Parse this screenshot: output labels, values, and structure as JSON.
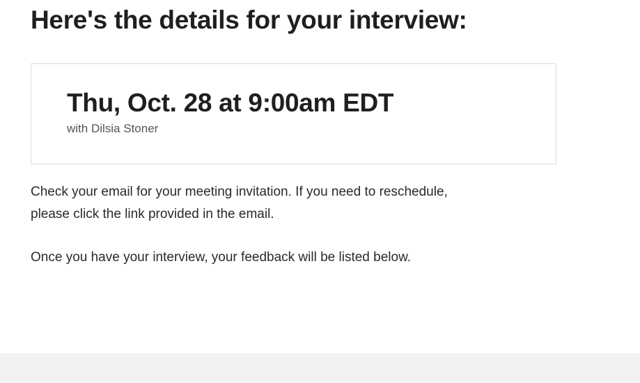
{
  "page": {
    "title": "Here's the details for your interview:"
  },
  "interview": {
    "datetime": "Thu, Oct. 28 at 9:00am EDT",
    "interviewer": "with Dilsia Stoner"
  },
  "info": {
    "line1": "Check your email for your meeting invitation. If you need to reschedule,",
    "line2": "please click the link provided in the email.",
    "line3": "Once you have your interview, your feedback will be listed below."
  },
  "colors": {
    "text": "#1f1f1f",
    "muted": "#555555",
    "card_border": "#dcdcdc",
    "footer_bg": "#f2f2f2"
  }
}
